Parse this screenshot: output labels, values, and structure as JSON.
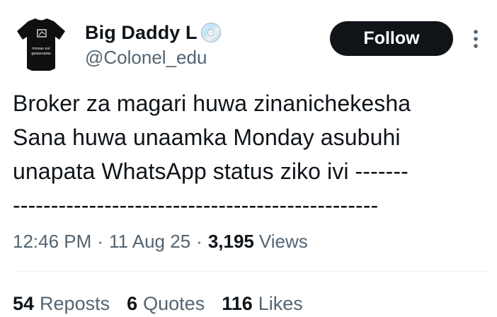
{
  "author": {
    "display_name": "Big Daddy L",
    "name_emoji": "cd-disc-icon",
    "handle": "@Colonel_edu",
    "avatar_text_line1": "moxas sul",
    "avatar_text_line2": "gasaxsalas"
  },
  "follow_button": {
    "label": "Follow"
  },
  "more_button": {
    "icon": "vertical-ellipsis-icon"
  },
  "tweet": {
    "text": "Broker za magari huwa zinanichekesha\nSana huwa unaamka Monday asubuhi\nunapata WhatsApp status ziko ivi -------\n------------------------------------------------"
  },
  "meta": {
    "time": "12:46 PM",
    "separator1": "·",
    "date": "11 Aug 25",
    "separator2": "·",
    "views_count": "3,195",
    "views_label": "Views"
  },
  "stats": {
    "reposts_count": "54",
    "reposts_label": "Reposts",
    "quotes_count": "6",
    "quotes_label": "Quotes",
    "likes_count": "116",
    "likes_label": "Likes"
  },
  "colors": {
    "primary_text": "#0f1419",
    "secondary_text": "#536471",
    "follow_bg": "#0f1419",
    "follow_text": "#ffffff",
    "divider": "#eff3f4"
  }
}
